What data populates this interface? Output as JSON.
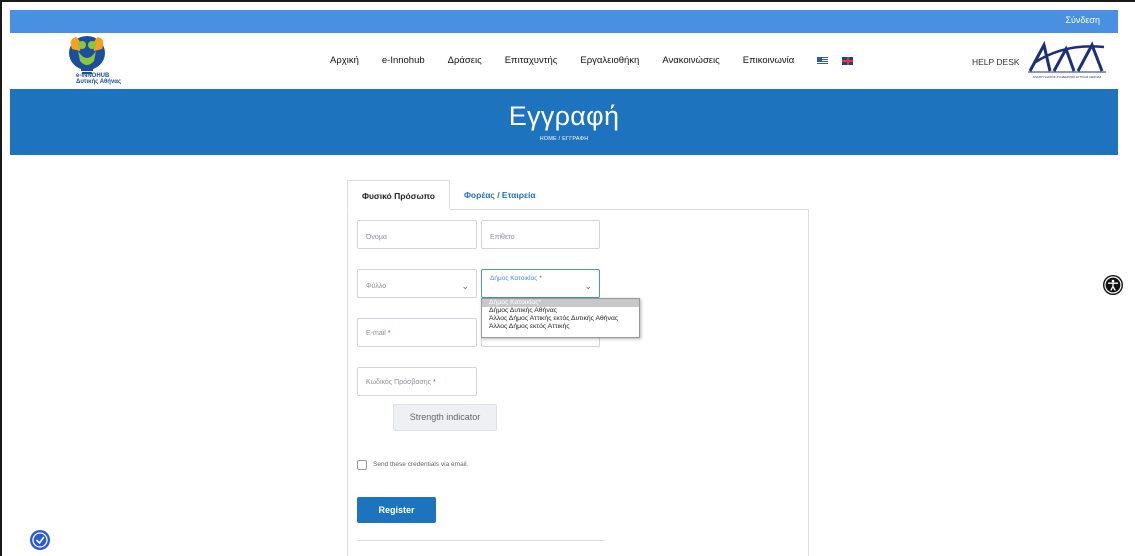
{
  "topbar": {
    "login_label": "Σύνδεση"
  },
  "header": {
    "logo_text_line1": "e-INNOHUB",
    "logo_text_line2": "Δυτικής Αθήνας",
    "nav": [
      "Αρχική",
      "e-Innohub",
      "Δράσεις",
      "Επιταχυντής",
      "Εργαλειοθήκη",
      "Ανακοινώσεις",
      "Επικοινωνία"
    ],
    "helpdesk_label": "HELP DESK",
    "partner_logo_sub": "ΑΝΑΠΤΥΞΙΑΚΟΣ ΣΥΝΔΕΣΜΟΣ ΔΥΤΙΚΗΣ ΑΘΗΝΑΣ"
  },
  "hero": {
    "title": "Εγγραφή",
    "breadcrumb": "HOME  /  ΕΓΓΡΑΦΗ"
  },
  "tabs": {
    "individual": "Φυσικό Πρόσωπο",
    "organization": "Φορέας / Εταιρεία"
  },
  "form": {
    "first_name": "Όνομα",
    "last_name": "Επίθετο",
    "gender": "Φύλλο",
    "municipality": "Δήμος Κατοικίας",
    "email": "E-mail",
    "password": "Κωδικός Πρόσβασης",
    "required_mark": "*",
    "strength_indicator": "Strength indicator",
    "send_credentials": "Send these credentials via email.",
    "register_label": "Register"
  },
  "municipality_options": [
    "Δήμος Κατοικίας*",
    "Δήμος Δυτικής Αθήνας",
    "Άλλος Δήμος Αττικής εκτός Δυτικής Αθήνας",
    "Άλλος Δήμος εκτός Αττικής"
  ],
  "colors": {
    "topbar": "#4a90e2",
    "hero": "#1e73be",
    "accent": "#1e73be",
    "required": "#d9342b"
  }
}
